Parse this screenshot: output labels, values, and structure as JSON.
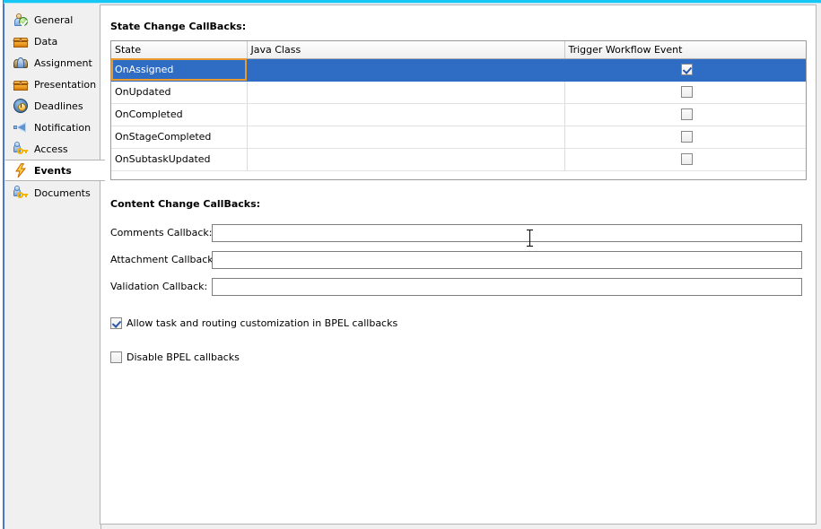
{
  "window": {
    "accent_color": "#16c7f5",
    "left_rail_color": "#4a78c8"
  },
  "sidebar": {
    "items": [
      {
        "label": "General",
        "icon": "person-check-icon",
        "selected": false
      },
      {
        "label": "Data",
        "icon": "box-icon",
        "selected": false
      },
      {
        "label": "Assignment",
        "icon": "group-icon",
        "selected": false
      },
      {
        "label": "Presentation",
        "icon": "box-icon",
        "selected": false
      },
      {
        "label": "Deadlines",
        "icon": "clock-icon",
        "selected": false
      },
      {
        "label": "Notification",
        "icon": "megaphone-icon",
        "selected": false
      },
      {
        "label": "Access",
        "icon": "person-key-icon",
        "selected": false
      },
      {
        "label": "Events",
        "icon": "lightning-bolt-icon",
        "selected": true
      },
      {
        "label": "Documents",
        "icon": "person-key-icon",
        "selected": false
      }
    ]
  },
  "main": {
    "state_change": {
      "title": "State Change CallBacks:",
      "columns": [
        "State",
        "Java Class",
        "Trigger Workflow Event"
      ],
      "rows": [
        {
          "state": "OnAssigned",
          "java_class": "",
          "trigger": true,
          "selected": true
        },
        {
          "state": "OnUpdated",
          "java_class": "",
          "trigger": false,
          "selected": false
        },
        {
          "state": "OnCompleted",
          "java_class": "",
          "trigger": false,
          "selected": false
        },
        {
          "state": "OnStageCompleted",
          "java_class": "",
          "trigger": false,
          "selected": false
        },
        {
          "state": "OnSubtaskUpdated",
          "java_class": "",
          "trigger": false,
          "selected": false
        }
      ],
      "selection_color": "#2f6dc4",
      "focus_border_color": "#e89a2c"
    },
    "content_change": {
      "title": "Content Change CallBacks:",
      "fields": [
        {
          "label": "Comments Callback:",
          "value": "",
          "placeholder": ""
        },
        {
          "label": "Attachment Callback:",
          "value": "",
          "placeholder": ""
        },
        {
          "label": "Validation Callback:",
          "value": "",
          "placeholder": ""
        }
      ]
    },
    "options": [
      {
        "label": "Allow task and routing customization in BPEL callbacks",
        "checked": true
      },
      {
        "label": "Disable BPEL callbacks",
        "checked": false
      }
    ]
  }
}
